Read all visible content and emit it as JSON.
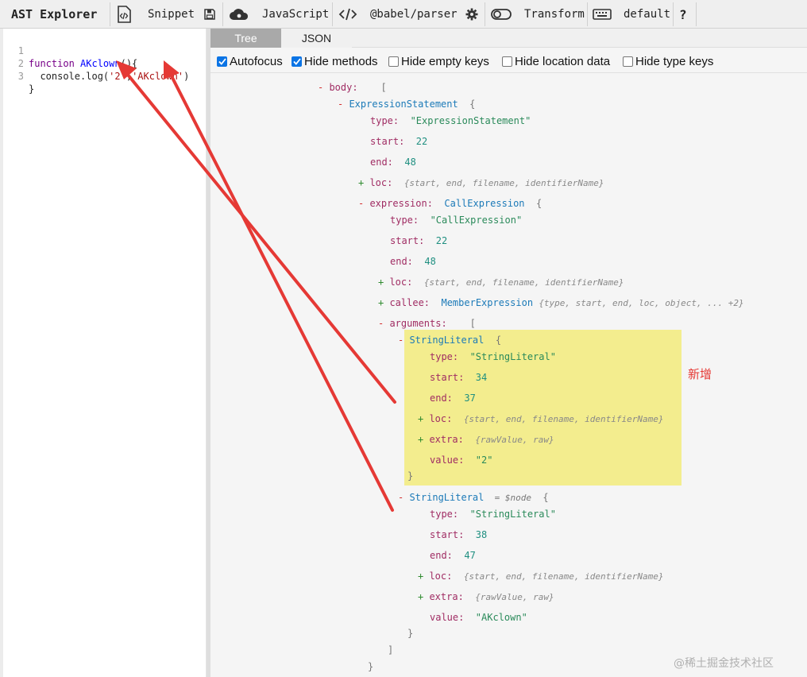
{
  "toolbar": {
    "brand": "AST Explorer",
    "snippet_label": "Snippet",
    "language_label": "JavaScript",
    "parser_label": "@babel/parser",
    "transform_label": "Transform",
    "keymap_label": "default",
    "help_label": "?"
  },
  "editor": {
    "lines": [
      {
        "num": "1",
        "segments": [
          {
            "t": "function ",
            "c": "kw"
          },
          {
            "t": "AKclown",
            "c": "fn"
          },
          {
            "t": "(){",
            "c": ""
          }
        ]
      },
      {
        "num": "2",
        "segments": [
          {
            "t": "  console.log(",
            "c": ""
          },
          {
            "t": "'2'",
            "c": "str"
          },
          {
            "t": ",",
            "c": ""
          },
          {
            "t": "'AKclown'",
            "c": "str"
          },
          {
            "t": ")",
            "c": ""
          }
        ]
      },
      {
        "num": "3",
        "segments": [
          {
            "t": "}",
            "c": ""
          }
        ]
      }
    ]
  },
  "output": {
    "tabs": [
      {
        "label": "Tree",
        "active": true
      },
      {
        "label": "JSON",
        "active": false
      }
    ],
    "options": [
      {
        "label": "Autofocus",
        "checked": true
      },
      {
        "label": "Hide methods",
        "checked": true
      },
      {
        "label": "Hide empty keys",
        "checked": false
      },
      {
        "label": "Hide location data",
        "checked": false
      },
      {
        "label": "Hide type keys",
        "checked": false
      }
    ]
  },
  "tree": [
    {
      "toggle": "-",
      "key": "body:",
      "rest": [
        {
          "t": "  [",
          "c": "brk"
        }
      ]
    },
    {
      "toggle": "-",
      "key": "",
      "rest": [
        {
          "t": "ExpressionStatement",
          "c": "nodename"
        },
        {
          "t": "  {",
          "c": "brk"
        }
      ]
    },
    {
      "toggle": "",
      "key": "type:",
      "rest": [
        {
          "t": "\"ExpressionStatement\"",
          "c": "strv"
        }
      ]
    },
    {
      "toggle": "",
      "key": "start:",
      "rest": [
        {
          "t": "22",
          "c": "numv"
        }
      ]
    },
    {
      "toggle": "",
      "key": "end:",
      "rest": [
        {
          "t": "48",
          "c": "numv"
        }
      ]
    },
    {
      "toggle": "+",
      "key": "loc:",
      "rest": [
        {
          "t": "{start, end, filename, identifierName}",
          "c": "summary"
        }
      ]
    },
    {
      "toggle": "-",
      "key": "expression:",
      "rest": [
        {
          "t": "CallExpression",
          "c": "nodename"
        },
        {
          "t": "  {",
          "c": "brk"
        }
      ]
    },
    {
      "toggle": "",
      "key": "type:",
      "rest": [
        {
          "t": "\"CallExpression\"",
          "c": "strv"
        }
      ]
    },
    {
      "toggle": "",
      "key": "start:",
      "rest": [
        {
          "t": "22",
          "c": "numv"
        }
      ]
    },
    {
      "toggle": "",
      "key": "end:",
      "rest": [
        {
          "t": "48",
          "c": "numv"
        }
      ]
    },
    {
      "toggle": "+",
      "key": "loc:",
      "rest": [
        {
          "t": "{start, end, filename, identifierName}",
          "c": "summary"
        }
      ]
    },
    {
      "toggle": "+",
      "key": "callee:",
      "rest": [
        {
          "t": "MemberExpression ",
          "c": "nodename"
        },
        {
          "t": "{type, start, end, loc, object, ... +2}",
          "c": "summary"
        }
      ]
    },
    {
      "toggle": "-",
      "key": "arguments:",
      "rest": [
        {
          "t": "  [",
          "c": "brk"
        }
      ]
    },
    {
      "toggle": "-",
      "key": "",
      "rest": [
        {
          "t": "StringLiteral",
          "c": "nodename"
        },
        {
          "t": "  {",
          "c": "brk"
        }
      ]
    },
    {
      "toggle": "",
      "key": "type:",
      "rest": [
        {
          "t": "\"StringLiteral\"",
          "c": "strv"
        }
      ]
    },
    {
      "toggle": "",
      "key": "start:",
      "rest": [
        {
          "t": "34",
          "c": "numv"
        }
      ]
    },
    {
      "toggle": "",
      "key": "end:",
      "rest": [
        {
          "t": "37",
          "c": "numv"
        }
      ]
    },
    {
      "toggle": "+",
      "key": "loc:",
      "rest": [
        {
          "t": "{start, end, filename, identifierName}",
          "c": "summary"
        }
      ]
    },
    {
      "toggle": "+",
      "key": "extra:",
      "rest": [
        {
          "t": "{rawValue, raw}",
          "c": "summary"
        }
      ]
    },
    {
      "toggle": "",
      "key": "value:",
      "rest": [
        {
          "t": "\"2\"",
          "c": "strv"
        }
      ]
    },
    {
      "toggle": "",
      "key": "",
      "rest": [
        {
          "t": "}",
          "c": "brk"
        }
      ]
    },
    {
      "toggle": "-",
      "key": "",
      "rest": [
        {
          "t": "StringLiteral",
          "c": "nodename"
        },
        {
          "t": "  = $node",
          "c": "ref"
        },
        {
          "t": "  {",
          "c": "brk"
        }
      ]
    },
    {
      "toggle": "",
      "key": "type:",
      "rest": [
        {
          "t": "\"StringLiteral\"",
          "c": "strv"
        }
      ]
    },
    {
      "toggle": "",
      "key": "start:",
      "rest": [
        {
          "t": "38",
          "c": "numv"
        }
      ]
    },
    {
      "toggle": "",
      "key": "end:",
      "rest": [
        {
          "t": "47",
          "c": "numv"
        }
      ]
    },
    {
      "toggle": "+",
      "key": "loc:",
      "rest": [
        {
          "t": "{start, end, filename, identifierName}",
          "c": "summary"
        }
      ]
    },
    {
      "toggle": "+",
      "key": "extra:",
      "rest": [
        {
          "t": "{rawValue, raw}",
          "c": "summary"
        }
      ]
    },
    {
      "toggle": "",
      "key": "value:",
      "rest": [
        {
          "t": "\"AKclown\"",
          "c": "strv"
        }
      ]
    },
    {
      "toggle": "",
      "key": "",
      "rest": [
        {
          "t": "}",
          "c": "brk"
        }
      ]
    },
    {
      "toggle": "",
      "key": "",
      "rest": [
        {
          "t": "]",
          "c": "brk"
        }
      ]
    },
    {
      "toggle": "",
      "key": "",
      "rest": [
        {
          "t": "}",
          "c": "brk"
        }
      ]
    }
  ],
  "annotation": {
    "text": "新增",
    "color": "#e53935"
  },
  "watermark": "@稀土掘金技术社区",
  "colors": {
    "highlight": "#f3ed8e",
    "arrow": "#e53935",
    "active_tab": "#a9a9a9",
    "checkbox": "#0b74e5"
  }
}
